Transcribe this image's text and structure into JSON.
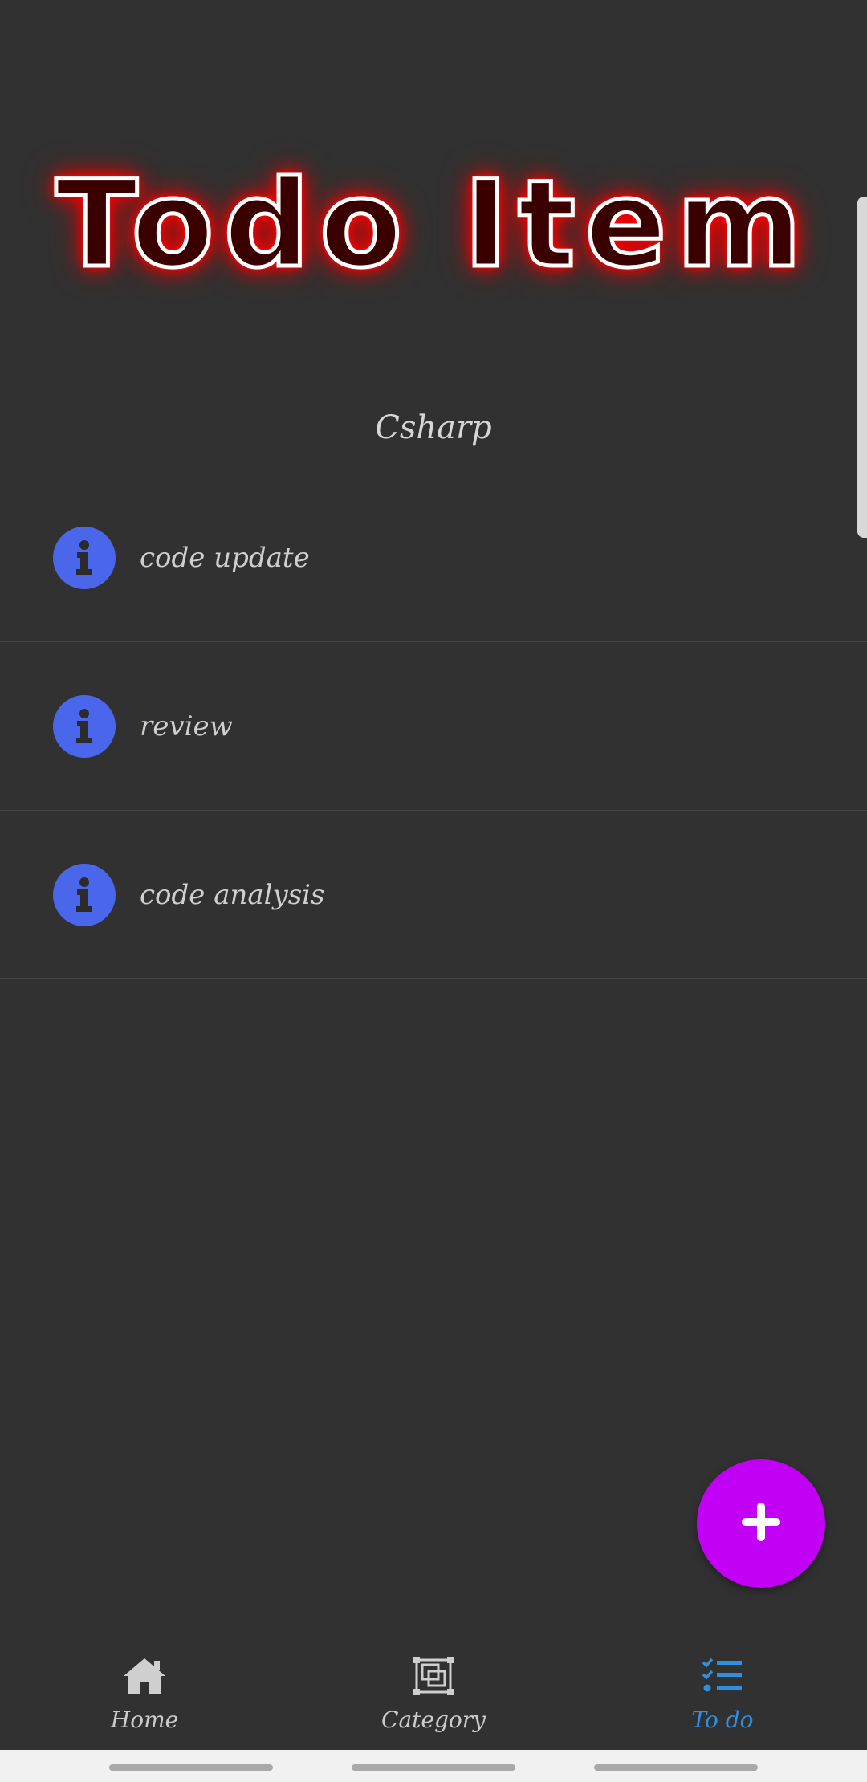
{
  "header": {
    "title": "Todo Item"
  },
  "category": {
    "name": "Csharp"
  },
  "todos": [
    {
      "label": "code update",
      "icon": "info-icon"
    },
    {
      "label": "review",
      "icon": "info-icon"
    },
    {
      "label": "code analysis",
      "icon": "info-icon"
    }
  ],
  "fab": {
    "icon": "plus-icon",
    "color": "#c100f5"
  },
  "bottom_nav": {
    "items": [
      {
        "label": "Home",
        "icon": "home-icon",
        "active": false
      },
      {
        "label": "Category",
        "icon": "category-icon",
        "active": false
      },
      {
        "label": "To do",
        "icon": "todo-list-icon",
        "active": true
      }
    ]
  },
  "colors": {
    "background": "#313131",
    "neon": "#ff0000",
    "info_icon": "#4a66ea",
    "active_nav": "#2f8fe0"
  }
}
